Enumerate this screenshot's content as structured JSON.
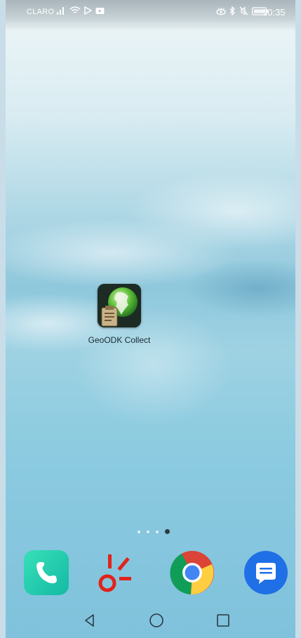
{
  "status_bar": {
    "carrier": "CLARO",
    "time": "10:35",
    "left_icons": [
      "signal-icon",
      "wifi-icon",
      "play-store-icon",
      "youtube-icon"
    ],
    "right_icons": [
      "eye-comfort-icon",
      "bluetooth-icon",
      "mute-icon",
      "battery-icon"
    ]
  },
  "home": {
    "apps": [
      {
        "label": "GeoODK Collect",
        "icon": "geoodk-collect-icon"
      }
    ],
    "page_indicator": {
      "pages": 4,
      "current": 4
    }
  },
  "dock": {
    "apps": [
      "phone-icon",
      "red-app-icon",
      "chrome-icon",
      "messages-icon"
    ]
  },
  "nav_bar": {
    "buttons": [
      "back-button",
      "home-button",
      "recents-button"
    ]
  },
  "colors": {
    "phone_app": "#22c9ab",
    "red_app": "#e2231a",
    "messages_app": "#1f6fe6"
  }
}
